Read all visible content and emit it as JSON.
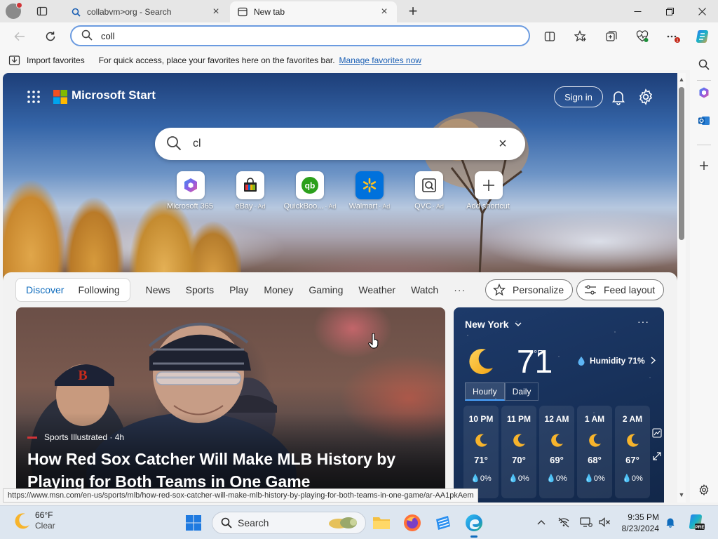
{
  "browser": {
    "tabs": [
      {
        "label": "collabvm>org - Search",
        "icon": "search-icon",
        "active": false
      },
      {
        "label": "New tab",
        "icon": "newtab-page-icon",
        "active": true
      }
    ],
    "address_bar": {
      "value": "coll",
      "icon": "search-icon"
    },
    "favorites_bar": {
      "import_label": "Import favorites",
      "message": "For quick access, place your favorites here on the favorites bar.",
      "link_label": "Manage favorites now"
    },
    "status_url": "https://www.msn.com/en-us/sports/mlb/how-red-sox-catcher-will-make-mlb-history-by-playing-for-both-teams-in-one-game/ar-AA1pkAem",
    "accent_color": "#0f6cbd"
  },
  "start": {
    "brand": "Microsoft Start",
    "sign_in_label": "Sign in",
    "search": {
      "value": "cl"
    },
    "quick_links": [
      {
        "label": "Microsoft 365",
        "ad": ""
      },
      {
        "label": "eBay",
        "ad": "· Ad"
      },
      {
        "label": "QuickBoo...",
        "ad": "· Ad"
      },
      {
        "label": "Walmart",
        "ad": "· Ad"
      },
      {
        "label": "QVC",
        "ad": "· Ad"
      },
      {
        "label": "Add shortcut",
        "ad": ""
      }
    ],
    "feed_nav": {
      "discover": "Discover",
      "following": "Following",
      "items": [
        "News",
        "Sports",
        "Play",
        "Money",
        "Gaming",
        "Weather",
        "Watch"
      ],
      "more": "···",
      "personalize": "Personalize",
      "feed_layout": "Feed layout"
    },
    "article": {
      "source": "Sports Illustrated · 4h",
      "headline": "How Red Sox Catcher Will Make MLB History by Playing for Both Teams in One Game"
    },
    "weather": {
      "location": "New York",
      "temp": "71",
      "unit": "°F",
      "humidity": "Humidity 71%",
      "tabs": [
        "Hourly",
        "Daily"
      ],
      "hourly": [
        {
          "time": "10 PM",
          "temp": "71°",
          "precip": "0%"
        },
        {
          "time": "11 PM",
          "temp": "70°",
          "precip": "0%"
        },
        {
          "time": "12 AM",
          "temp": "69°",
          "precip": "0%"
        },
        {
          "time": "1 AM",
          "temp": "68°",
          "precip": "0%"
        },
        {
          "time": "2 AM",
          "temp": "67°",
          "precip": "0%"
        }
      ]
    }
  },
  "taskbar": {
    "weather": {
      "temp": "66°F",
      "condition": "Clear"
    },
    "search_label": "Search",
    "time": "9:35 PM",
    "date": "8/23/2024"
  }
}
